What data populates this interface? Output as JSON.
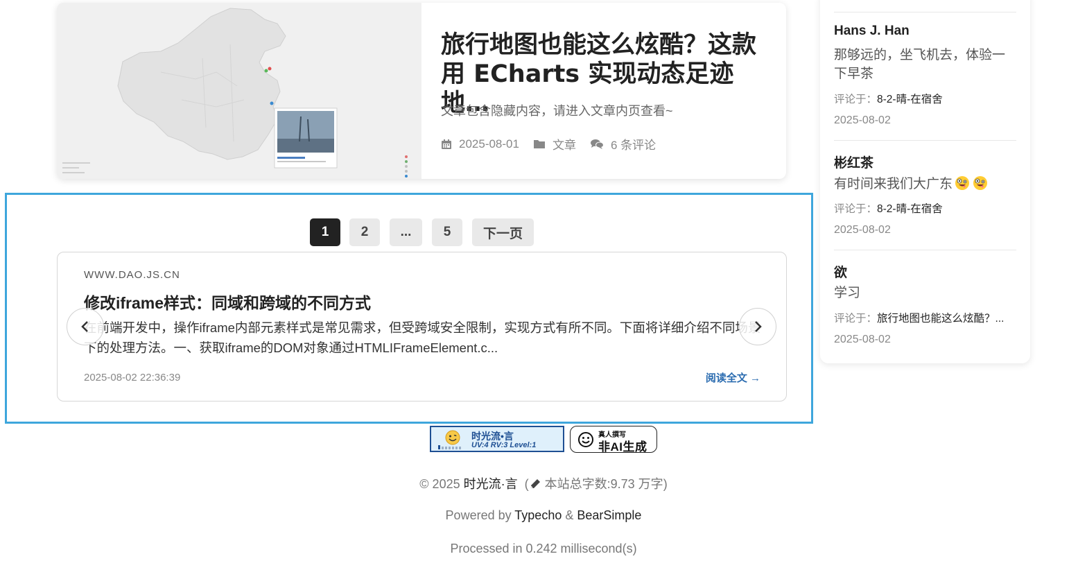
{
  "post": {
    "title": "旅行地图也能这么炫酷？这款用 ECharts 实现动态足迹地…",
    "excerpt": "文章包含隐藏内容，请进入文章内页查看~",
    "date": "2025-08-01",
    "category": "文章",
    "comments": "6 条评论",
    "icons": [
      "calendar-icon",
      "folder-icon",
      "comments-icon"
    ]
  },
  "pagination": {
    "pages": [
      "1",
      "2",
      "...",
      "5"
    ],
    "next_label": "下一页",
    "active": "1"
  },
  "recommend": {
    "domain": "WWW.DAO.JS.CN",
    "title": "修改iframe样式：同域和跨域的不同方式",
    "desc": "在前端开发中，操作iframe内部元素样式是常见需求，但受跨域安全限制，实现方式有所不同。下面将详细介绍不同场景下的处理方法。一、获取iframe的DOM对象通过HTMLIFrameElement.c...",
    "datetime": "2025-08-02 22:36:39",
    "read_more": "阅读全文 →"
  },
  "badges": {
    "counter_title": "时光流•言",
    "counter_stats": "UV:4 RV:3 Level:1",
    "human_small": "真人撰写",
    "human_big": "非AI生成"
  },
  "footer": {
    "copyright_prefix": "© 2025",
    "site_name": "时光流·言",
    "word_count": "本站总字数:9.73 万字",
    "powered_prefix": "Powered by",
    "typecho": "Typecho",
    "amp": "&",
    "theme": "BearSimple",
    "processed": "Processed in 0.242 millisecond(s)"
  },
  "comments": [
    {
      "name": "Hans J. Han",
      "text": "那够远的，坐飞机去，体验一下早茶",
      "on_label": "评论于：",
      "post": "8-2-晴-在宿舍",
      "date": "2025-08-02"
    },
    {
      "name": "彬红茶",
      "text": "有时间来我们大广东",
      "on_label": "评论于：",
      "post": "8-2-晴-在宿舍",
      "date": "2025-08-02"
    },
    {
      "name": "欲",
      "text": "学习",
      "on_label": "评论于：",
      "post": "旅行地图也能这么炫酷？...",
      "date": "2025-08-02"
    }
  ],
  "colors": {
    "accent_frame": "#3ea6dc",
    "link": "#2b6cb0",
    "active_page": "#222222"
  }
}
